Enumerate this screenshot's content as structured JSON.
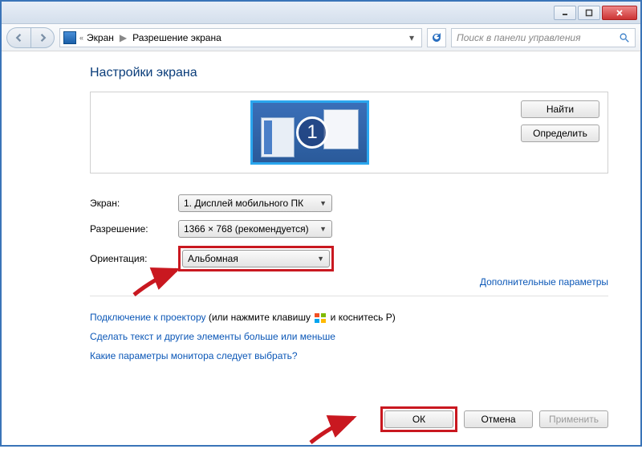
{
  "titlebar": {},
  "nav": {
    "breadcrumb_prefix": "«",
    "crumb1": "Экран",
    "crumb2": "Разрешение экрана",
    "search_placeholder": "Поиск в панели управления"
  },
  "page": {
    "title": "Настройки экрана",
    "find_btn": "Найти",
    "identify_btn": "Определить",
    "monitor_number": "1"
  },
  "form": {
    "display_label": "Экран:",
    "display_value": "1. Дисплей мобильного ПК",
    "resolution_label": "Разрешение:",
    "resolution_value": "1366 × 768 (рекомендуется)",
    "orientation_label": "Ориентация:",
    "orientation_value": "Альбомная",
    "advanced_link": "Дополнительные параметры"
  },
  "hints": {
    "projector_link": "Подключение к проектору",
    "projector_rest_a": " (или нажмите клавишу ",
    "projector_rest_b": " и коснитесь P)",
    "textsize_link": "Сделать текст и другие элементы больше или меньше",
    "whichmon_link": "Какие параметры монитора следует выбрать?"
  },
  "footer": {
    "ok": "ОК",
    "cancel": "Отмена",
    "apply": "Применить"
  }
}
